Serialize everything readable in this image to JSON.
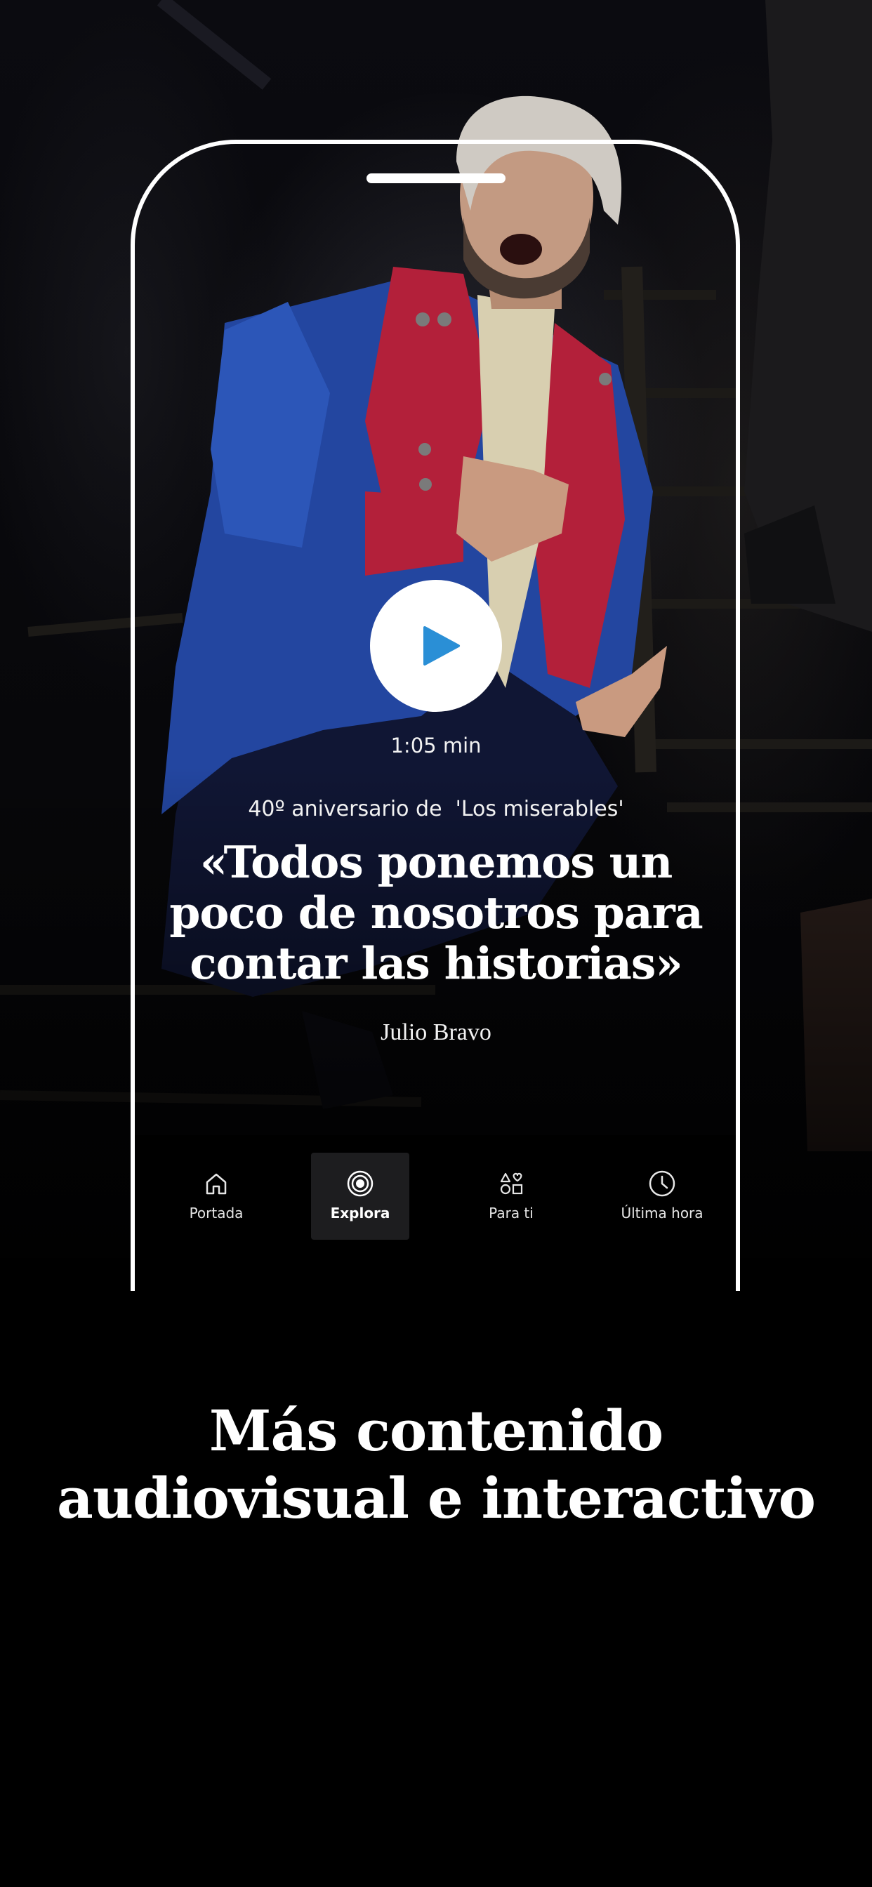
{
  "player": {
    "duration": "1:05 min",
    "play_icon": "play-icon",
    "accent_color": "#2a8fd6"
  },
  "article": {
    "kicker": "40º aniversario de  'Los miserables'",
    "headline": "«Todos ponemos un poco de nosotros para contar las historias»",
    "author": "Julio Bravo"
  },
  "nav": {
    "active": "Explora",
    "items": [
      {
        "label": "Portada",
        "icon": "home-icon"
      },
      {
        "label": "Explora",
        "icon": "target-icon"
      },
      {
        "label": "Para ti",
        "icon": "shapes-icon"
      },
      {
        "label": "Última hora",
        "icon": "clock-icon"
      }
    ]
  },
  "promo": {
    "title": "Más contenido audiovisual e interactivo"
  }
}
